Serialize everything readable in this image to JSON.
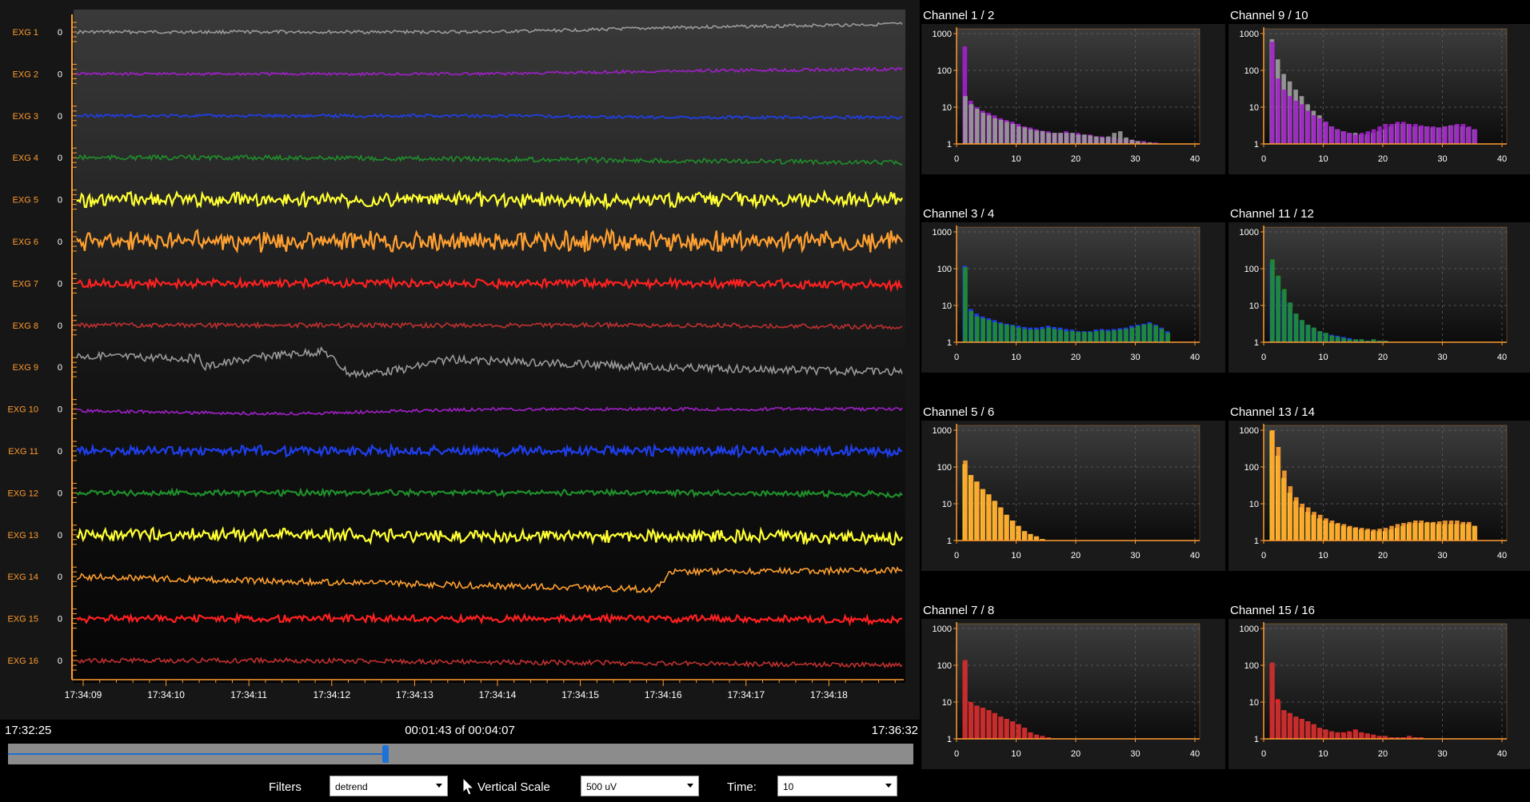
{
  "channels": [
    {
      "label": "EXG 1",
      "zero": "0",
      "color": "#9a9a9a"
    },
    {
      "label": "EXG 2",
      "zero": "0",
      "color": "#a020c8"
    },
    {
      "label": "EXG 3",
      "zero": "0",
      "color": "#1f3ff0"
    },
    {
      "label": "EXG 4",
      "zero": "0",
      "color": "#1f8f2a"
    },
    {
      "label": "EXG 5",
      "zero": "0",
      "color": "#ffff33"
    },
    {
      "label": "EXG 6",
      "zero": "0",
      "color": "#ffa030"
    },
    {
      "label": "EXG 7",
      "zero": "0",
      "color": "#ff2020"
    },
    {
      "label": "EXG 8",
      "zero": "0",
      "color": "#c03030"
    },
    {
      "label": "EXG 9",
      "zero": "0",
      "color": "#9a9a9a"
    },
    {
      "label": "EXG 10",
      "zero": "0",
      "color": "#a020c8"
    },
    {
      "label": "EXG 11",
      "zero": "0",
      "color": "#1f3ff0"
    },
    {
      "label": "EXG 12",
      "zero": "0",
      "color": "#1f8f2a"
    },
    {
      "label": "EXG 13",
      "zero": "0",
      "color": "#ffff33"
    },
    {
      "label": "EXG 14",
      "zero": "0",
      "color": "#ffa030"
    },
    {
      "label": "EXG 15",
      "zero": "0",
      "color": "#ff2020"
    },
    {
      "label": "EXG 16",
      "zero": "0",
      "color": "#c03030"
    }
  ],
  "time_ticks": [
    "17:34:09",
    "17:34:10",
    "17:34:11",
    "17:34:12",
    "17:34:13",
    "17:34:14",
    "17:34:15",
    "17:34:16",
    "17:34:17",
    "17:34:18"
  ],
  "timeline": {
    "start": "17:32:25",
    "position": "00:01:43 of 00:04:07",
    "end": "17:36:32",
    "progress": 0.417
  },
  "controls": {
    "filters_label": "Filters",
    "filters_value": "detrend",
    "vscale_label": "Vertical Scale",
    "vscale_value": "500 uV",
    "time_label": "Time:",
    "time_value": "10"
  },
  "icons": {
    "cursor": "mouse-pointer-icon",
    "dropdown": "chevron-down-icon"
  },
  "chart_data": [
    {
      "type": "bar",
      "title": "Channel 1 / 2",
      "y_scale": "log",
      "ylim": [
        1,
        1000
      ],
      "y_ticks": [
        "1000",
        "100",
        "10",
        "1"
      ],
      "xlim": [
        0,
        40
      ],
      "x_ticks": [
        "0",
        "10",
        "20",
        "30",
        "40"
      ],
      "series": [
        {
          "color": "#a020c8",
          "values": [
            1,
            450,
            15,
            10,
            8,
            7,
            6,
            5,
            4.5,
            4,
            3.5,
            3,
            2.8,
            2.5,
            2.3,
            2.2,
            2,
            2,
            2.2,
            2,
            2,
            1.8,
            1.8,
            1.6,
            1.6,
            1.5,
            1.5,
            1.4,
            1.4,
            1.3,
            1.2,
            1.2,
            1.1,
            1.1,
            1
          ]
        },
        {
          "color": "#9a9a9a",
          "values": [
            1,
            20,
            12,
            9,
            7,
            6,
            5,
            4.5,
            4,
            3.5,
            3,
            2.8,
            2.5,
            2.3,
            2.2,
            2,
            2,
            2,
            2,
            2,
            1.8,
            1.8,
            1.7,
            1.6,
            1.5,
            1.6,
            2,
            2.2,
            1.5,
            1.3,
            1.2,
            1.1,
            1.1,
            1,
            1
          ]
        }
      ]
    },
    {
      "type": "bar",
      "title": "Channel 9 / 10",
      "y_scale": "log",
      "ylim": [
        1,
        1000
      ],
      "y_ticks": [
        "1000",
        "100",
        "10",
        "1"
      ],
      "xlim": [
        0,
        40
      ],
      "x_ticks": [
        "0",
        "10",
        "20",
        "30",
        "40"
      ],
      "series": [
        {
          "color": "#9a9a9a",
          "values": [
            1,
            700,
            200,
            80,
            50,
            30,
            20,
            12,
            8,
            6,
            4,
            3,
            2.5,
            2.2,
            2,
            2,
            1.8,
            1.8,
            2,
            2.2,
            2.5,
            3,
            3.5,
            3.5,
            3.5,
            3,
            3,
            3,
            2.8,
            2.8,
            3,
            3.2,
            3.2,
            3,
            2.8,
            2.5
          ]
        },
        {
          "color": "#a020c8",
          "values": [
            1,
            600,
            60,
            30,
            20,
            15,
            12,
            8,
            6,
            5,
            4,
            3,
            2.5,
            2.2,
            2,
            1.8,
            2,
            2.2,
            2.5,
            3,
            3.5,
            3.5,
            4,
            4,
            3.5,
            3.5,
            3.2,
            3,
            3,
            2.8,
            3,
            3.2,
            3.5,
            3.5,
            3,
            2.5
          ]
        }
      ]
    },
    {
      "type": "bar",
      "title": "Channel 3 / 4",
      "y_scale": "log",
      "ylim": [
        1,
        1000
      ],
      "y_ticks": [
        "1000",
        "100",
        "10",
        "1"
      ],
      "xlim": [
        0,
        40
      ],
      "x_ticks": [
        "0",
        "10",
        "20",
        "30",
        "40"
      ],
      "series": [
        {
          "color": "#1f3ff0",
          "values": [
            1,
            120,
            8,
            6,
            5,
            4.5,
            4,
            3.5,
            3.2,
            3,
            2.8,
            2.6,
            2.5,
            2.5,
            2.6,
            2.8,
            2.6,
            2.5,
            2.3,
            2.2,
            2,
            2,
            2,
            2.2,
            2.3,
            2.2,
            2.3,
            2.4,
            2.5,
            2.8,
            3,
            3.2,
            3.5,
            3,
            2.5,
            2
          ]
        },
        {
          "color": "#1f8f2a",
          "values": [
            1,
            110,
            7,
            5,
            4.5,
            4,
            3.5,
            3.2,
            3,
            2.8,
            2.5,
            2.3,
            2.2,
            2.2,
            2.3,
            2.5,
            2.3,
            2.2,
            2,
            2,
            1.9,
            1.9,
            1.9,
            2,
            2.1,
            2,
            2.1,
            2.2,
            2.3,
            2.5,
            2.8,
            3,
            3.2,
            2.8,
            2.3,
            1.8
          ]
        }
      ]
    },
    {
      "type": "bar",
      "title": "Channel 11 / 12",
      "y_scale": "log",
      "ylim": [
        1,
        1000
      ],
      "y_ticks": [
        "1000",
        "100",
        "10",
        "1"
      ],
      "xlim": [
        0,
        40
      ],
      "x_ticks": [
        "0",
        "10",
        "20",
        "30",
        "40"
      ],
      "series": [
        {
          "color": "#1f3ff0",
          "values": [
            1,
            150,
            60,
            25,
            12,
            6,
            4,
            3,
            2.5,
            2,
            1.8,
            1.6,
            1.5,
            1.4,
            1.3,
            1.2,
            1.2,
            1.1,
            1.2,
            1.1,
            1.1,
            1,
            1,
            1,
            1,
            1,
            1,
            1,
            1,
            1,
            1,
            1,
            1,
            1,
            1,
            1
          ]
        },
        {
          "color": "#1f8f2a",
          "values": [
            1,
            180,
            65,
            28,
            12,
            6,
            4,
            3,
            2.5,
            2,
            1.8,
            1.5,
            1.4,
            1.3,
            1.2,
            1.2,
            1.2,
            1.1,
            1.2,
            1.1,
            1.1,
            1,
            1,
            1,
            1,
            1,
            1,
            1,
            1,
            1,
            1,
            1,
            1,
            1,
            1,
            1
          ]
        }
      ]
    },
    {
      "type": "bar",
      "title": "Channel 5 / 6",
      "y_scale": "log",
      "ylim": [
        1,
        1000
      ],
      "y_ticks": [
        "1000",
        "100",
        "10",
        "1"
      ],
      "xlim": [
        0,
        40
      ],
      "x_ticks": [
        "0",
        "10",
        "20",
        "30",
        "40"
      ],
      "series": [
        {
          "color": "#ffff33",
          "values": [
            1,
            120,
            60,
            40,
            25,
            18,
            12,
            8,
            5,
            3.5,
            2.5,
            1.8,
            1.5,
            1.3,
            1.1,
            1,
            1,
            1,
            1,
            1,
            1,
            1,
            1,
            1,
            1,
            1,
            1,
            1,
            1,
            1,
            1,
            1,
            1,
            1,
            1,
            1
          ]
        },
        {
          "color": "#ffa030",
          "values": [
            1,
            150,
            60,
            40,
            25,
            18,
            12,
            8,
            5,
            3.5,
            2.5,
            1.8,
            1.5,
            1.3,
            1.1,
            1,
            1,
            1,
            1,
            1,
            1,
            1,
            1,
            1,
            1,
            1,
            1,
            1,
            1,
            1,
            1,
            1,
            1,
            1,
            1,
            1
          ]
        }
      ]
    },
    {
      "type": "bar",
      "title": "Channel 13 / 14",
      "y_scale": "log",
      "ylim": [
        1,
        1000
      ],
      "y_ticks": [
        "1000",
        "100",
        "10",
        "1"
      ],
      "xlim": [
        0,
        40
      ],
      "x_ticks": [
        "0",
        "10",
        "20",
        "30",
        "40"
      ],
      "series": [
        {
          "color": "#ffff33",
          "values": [
            1,
            950,
            200,
            50,
            20,
            12,
            8,
            6,
            5,
            4,
            3.5,
            3,
            2.8,
            2.5,
            2.3,
            2.2,
            2,
            1.9,
            1.8,
            1.8,
            1.8,
            2,
            2.2,
            2.5,
            2.8,
            3,
            3,
            3,
            3,
            2.8,
            2.8,
            2.8,
            2.8,
            2.8,
            2.8,
            2.5
          ]
        },
        {
          "color": "#ffa030",
          "values": [
            1,
            1000,
            350,
            80,
            30,
            15,
            10,
            8,
            6,
            5,
            4,
            3.5,
            3,
            2.8,
            2.5,
            2.3,
            2.2,
            2.1,
            2,
            2.1,
            2.2,
            2.5,
            2.8,
            3,
            3.2,
            3.5,
            3.5,
            3.2,
            3.2,
            3.3,
            3.5,
            3.5,
            3.5,
            3.2,
            3.2,
            2.5
          ]
        }
      ]
    },
    {
      "type": "bar",
      "title": "Channel 7 / 8",
      "y_scale": "log",
      "ylim": [
        1,
        1000
      ],
      "y_ticks": [
        "1000",
        "100",
        "10",
        "1"
      ],
      "xlim": [
        0,
        40
      ],
      "x_ticks": [
        "0",
        "10",
        "20",
        "30",
        "40"
      ],
      "series": [
        {
          "color": "#ff2020",
          "values": [
            1,
            130,
            10,
            8,
            7,
            6,
            5,
            4,
            3.5,
            3,
            2.5,
            2,
            1.5,
            1.3,
            1.2,
            1.1,
            1,
            1,
            1,
            1,
            1,
            1,
            1,
            1,
            1,
            1,
            1,
            1,
            1,
            1,
            1,
            1,
            1,
            1,
            1,
            1
          ]
        },
        {
          "color": "#c03030",
          "values": [
            1,
            140,
            9,
            8,
            7,
            6,
            5,
            4,
            3.5,
            3,
            2.5,
            2,
            1.5,
            1.3,
            1.2,
            1.1,
            1,
            1,
            1,
            1,
            1,
            1,
            1,
            1,
            1,
            1,
            1,
            1,
            1,
            1,
            1,
            1,
            1,
            1,
            1,
            1
          ]
        }
      ]
    },
    {
      "type": "bar",
      "title": "Channel 15 / 16",
      "y_scale": "log",
      "ylim": [
        1,
        1000
      ],
      "y_ticks": [
        "1000",
        "100",
        "10",
        "1"
      ],
      "xlim": [
        0,
        40
      ],
      "x_ticks": [
        "0",
        "10",
        "20",
        "30",
        "40"
      ],
      "series": [
        {
          "color": "#ff2020",
          "values": [
            1,
            110,
            12,
            6,
            5,
            4,
            3.5,
            3,
            2.5,
            2,
            1.8,
            1.6,
            1.5,
            1.5,
            1.6,
            1.8,
            1.5,
            1.4,
            1.3,
            1.2,
            1.2,
            1.1,
            1.1,
            1.1,
            1.2,
            1.1,
            1.1,
            1,
            1,
            1,
            1,
            1,
            1,
            1,
            1,
            1
          ]
        },
        {
          "color": "#c03030",
          "values": [
            1,
            120,
            10,
            6,
            5,
            4,
            3.5,
            3,
            2.5,
            2,
            1.8,
            1.6,
            1.5,
            1.4,
            1.5,
            1.7,
            1.5,
            1.4,
            1.3,
            1.2,
            1.2,
            1.1,
            1.1,
            1.1,
            1.2,
            1.1,
            1.1,
            1,
            1,
            1,
            1,
            1,
            1,
            1,
            1,
            1
          ]
        }
      ]
    }
  ]
}
